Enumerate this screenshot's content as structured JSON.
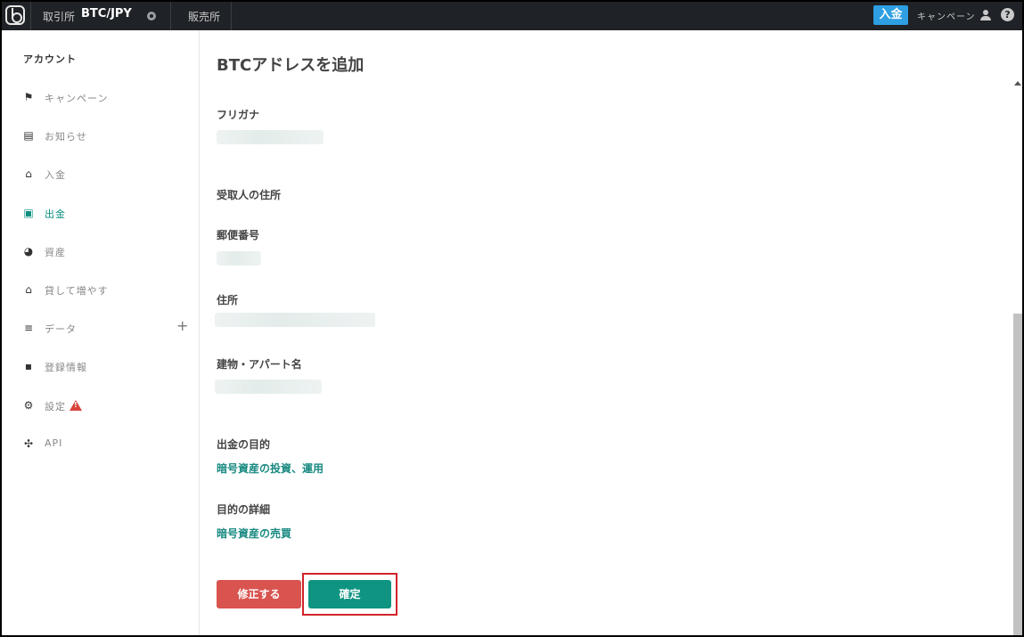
{
  "topbar": {
    "exchange_label": "取引所",
    "pair": "BTC/JPY",
    "sales_label": "販売所",
    "deposit_button": "入金",
    "campaign_link": "キャンペーン",
    "help_icon": "?"
  },
  "sidebar": {
    "heading": "アカウント",
    "items": [
      {
        "label": "キャンペーン",
        "icon": "flag-icon"
      },
      {
        "label": "お知らせ",
        "icon": "message-icon"
      },
      {
        "label": "入金",
        "icon": "bank-icon"
      },
      {
        "label": "出金",
        "icon": "wallet-icon",
        "active": true
      },
      {
        "label": "資産",
        "icon": "pie-chart-icon"
      },
      {
        "label": "貸して増やす",
        "icon": "bank-icon"
      },
      {
        "label": "データ",
        "icon": "database-icon",
        "expand": "+"
      },
      {
        "label": "登録情報",
        "icon": "id-badge-icon"
      },
      {
        "label": "設定",
        "icon": "gear-icon",
        "warning": true
      },
      {
        "label": "API",
        "icon": "api-icon"
      }
    ]
  },
  "main": {
    "title": "BTCアドレスを追加",
    "furigana_label": "フリガナ",
    "recipient_address_label": "受取人の住所",
    "postal_code_label": "郵便番号",
    "address_label": "住所",
    "building_label": "建物・アパート名",
    "purpose_label": "出金の目的",
    "purpose_value": "暗号資産の投資、運用",
    "purpose_detail_label": "目的の詳細",
    "purpose_detail_value": "暗号資産の売買",
    "edit_button": "修正する",
    "confirm_button": "確定"
  },
  "colors": {
    "topbar_bg": "#1f2226",
    "accent_teal": "#0f9482",
    "deposit_blue": "#2d9fe2",
    "edit_red": "#d9534f",
    "highlight_red": "#d2232a"
  }
}
